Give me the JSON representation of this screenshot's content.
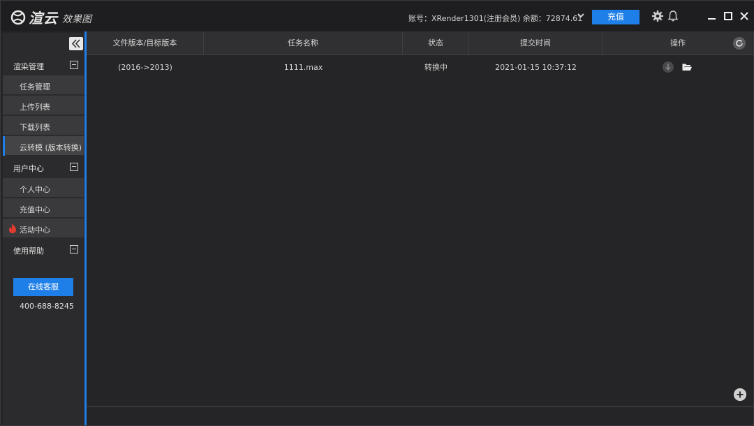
{
  "app": {
    "logo_text": "渲云",
    "logo_sub": "效果图"
  },
  "header": {
    "account_text": "账号：XRender1301(注册会员) 余额：72874.61",
    "recharge_label": "充值"
  },
  "sidebar": {
    "groups": [
      {
        "label": "渲染管理",
        "items": [
          "任务管理",
          "上传列表",
          "下载列表",
          "云转模 (版本转换)"
        ]
      },
      {
        "label": "用户中心",
        "items": [
          "个人中心",
          "充值中心",
          "活动中心"
        ]
      },
      {
        "label": "使用帮助",
        "items": []
      }
    ],
    "active_item": "云转模 (版本转换)",
    "service_button": "在线客服",
    "phone": "400-688-8245"
  },
  "table": {
    "headers": [
      "文件版本/目标版本",
      "任务名称",
      "状态",
      "提交时间",
      "操作"
    ],
    "rows": [
      {
        "version": "(2016->2013)",
        "name": "1111.max",
        "status": "转换中",
        "time": "2021-01-15 10:37:12"
      }
    ]
  },
  "colors": {
    "accent": "#1f7fe8",
    "background": "#252527",
    "fire": "#e23b2e"
  },
  "icons": [
    "logo-mark-icon",
    "chevron-down-icon",
    "gear-icon",
    "bell-icon",
    "minimize-icon",
    "maximize-icon",
    "close-icon",
    "double-chevron-left-icon",
    "fire-icon",
    "refresh-icon",
    "download-icon",
    "open-folder-icon",
    "add-icon"
  ]
}
